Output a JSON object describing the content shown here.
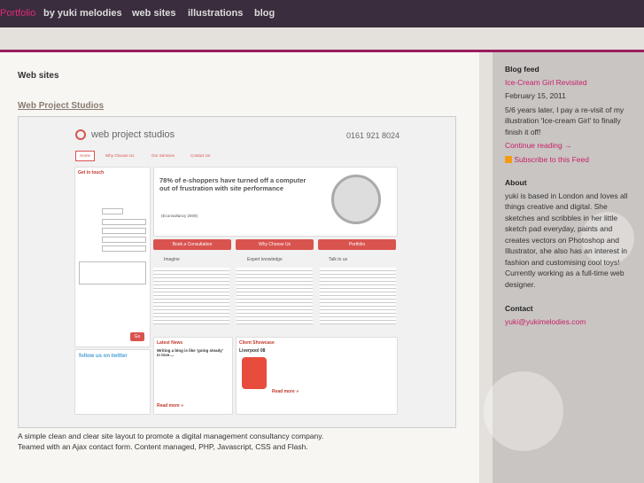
{
  "nav": {
    "brand_pink": "Portfolio",
    "brand_rest": "by yuki melodies",
    "links": [
      "web sites",
      "illustrations",
      "blog"
    ]
  },
  "main": {
    "heading": "Web sites",
    "project_title": "Web Project Studios",
    "description_line1": "A simple clean and clear site layout to promote a digital management consultancy company.",
    "description_line2": "Teamed with an Ajax contact form. Content managed, PHP, Javascript, CSS and Flash."
  },
  "sidebar": {
    "blog_heading": "Blog feed",
    "post_title": "Ice-Cream Girl Revisited",
    "post_date": "February 15, 2011",
    "post_excerpt": "5/6 years later, I pay a re-visit of my illustration 'Ice-cream Girl' to finally finish it off!",
    "continue": "Continue reading →",
    "subscribe": "Subscribe to this Feed",
    "about_heading": "About",
    "about_text": "yuki is based in London and loves all things creative and digital. She sketches and scribbles in her little sketch pad everyday, paints and creates vectors on Photoshop and Illustrator, she also has an interest in fashion and customising cool toys! Currently working as a full-time web designer.",
    "contact_heading": "Contact",
    "contact_email": "yuki@yukimelodies.com"
  },
  "shot": {
    "logo": "web project studios",
    "phone": "0161 921 8024",
    "tabs": [
      "Home",
      "Why Choose Us",
      "Our Services",
      "Contact Us"
    ],
    "get_in_touch": "Get in touch",
    "hero": "78% of e-shoppers have turned off a computer out of frustration with site performance",
    "hero_source": "(Econsultancy 2009)",
    "buttons": [
      "Book a Consultation",
      "Why Choose Us",
      "Portfolio"
    ],
    "cols": [
      "Imagine",
      "Expert knowledge",
      "Talk to us"
    ],
    "latest_news": "Latest News",
    "client_showcase": "Client Showcase",
    "news_title": "Writing a blog is like 'going steady' in love....",
    "client": "Liverpool 08",
    "read_more": "Read more »",
    "follow": "follow us on twitter",
    "go": "Go"
  }
}
